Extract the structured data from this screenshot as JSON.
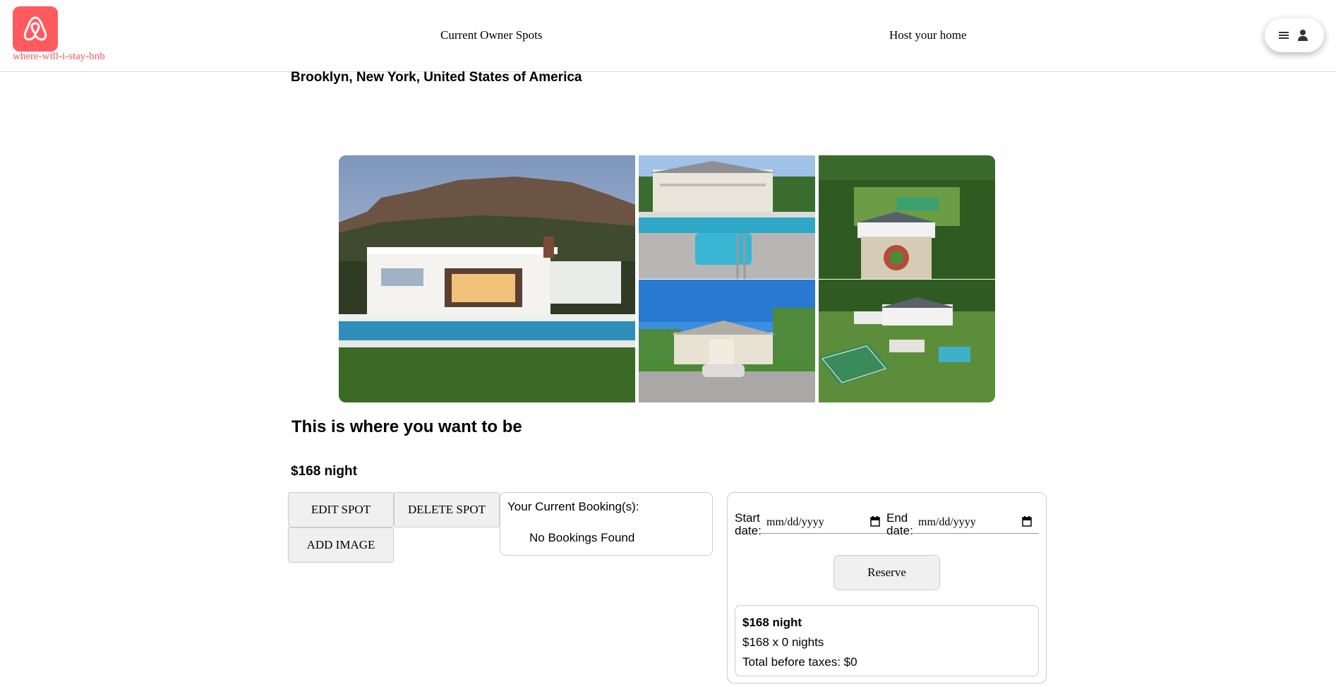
{
  "header": {
    "site_name": "where-will-i-stay-bnb",
    "nav": {
      "current_owner_spots": "Current Owner Spots",
      "host_your_home": "Host your home"
    },
    "brand_color": "#ff5a5f"
  },
  "spot": {
    "location": "Brooklyn, New York, United States of America",
    "title": "This is where you want to be",
    "price_night": "$168 night"
  },
  "actions": {
    "edit": "EDIT SPOT",
    "delete": "DELETE SPOT",
    "add_image": "ADD IMAGE"
  },
  "bookings": {
    "title": "Your Current Booking(s):",
    "empty": "No Bookings Found"
  },
  "reservation": {
    "start_label_1": "Start",
    "start_label_2": "date:",
    "end_label_1": "End",
    "end_label_2": "date:",
    "date_placeholder": "mm/dd/yyyy",
    "reserve_label": "Reserve",
    "summary": {
      "price": "$168 night",
      "calc": "$168 x 0 nights",
      "total": "Total before taxes: $0"
    }
  }
}
